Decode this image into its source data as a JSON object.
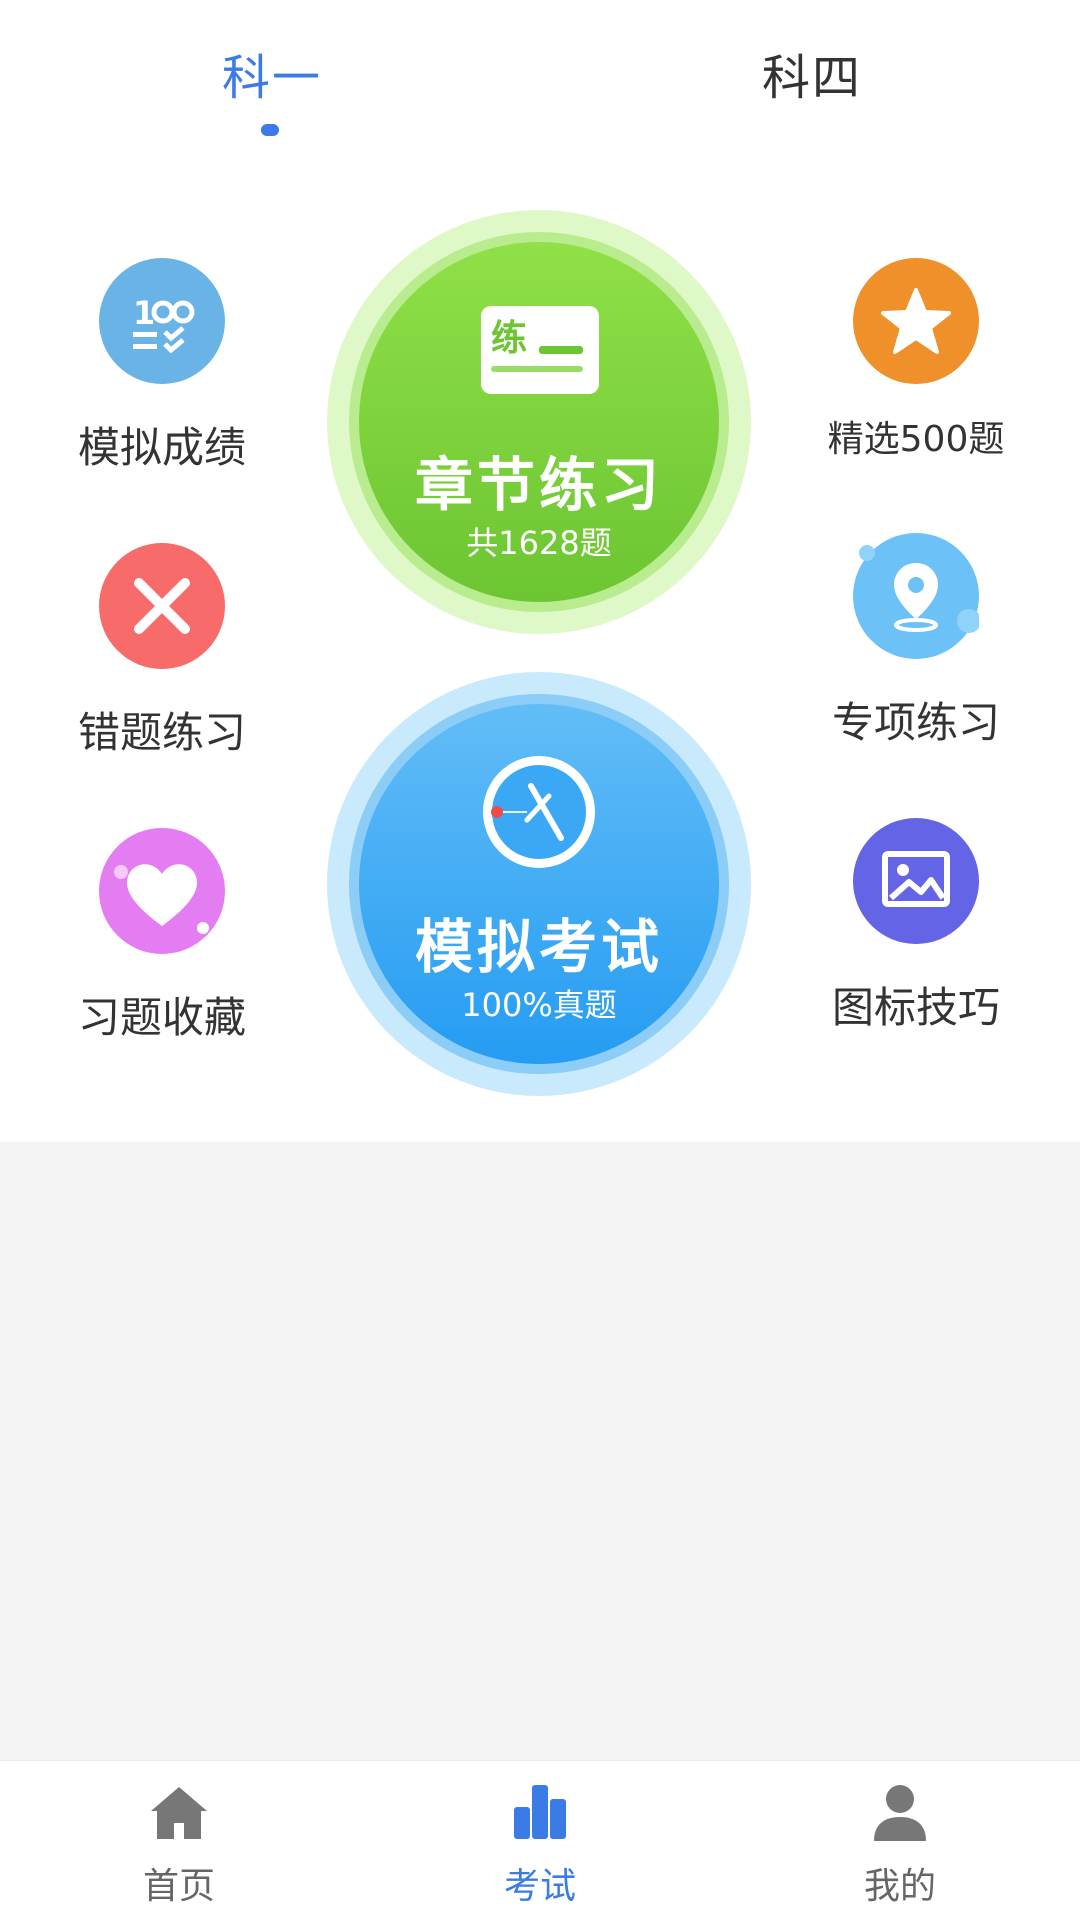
{
  "tabs": [
    {
      "label": "科一",
      "active": true
    },
    {
      "label": "科四",
      "active": false
    }
  ],
  "left_items": [
    {
      "label": "模拟成绩",
      "icon": "score-100-icon",
      "color": "#6ab3e6"
    },
    {
      "label": "错题练习",
      "icon": "close-x-icon",
      "color": "#f76b6b"
    },
    {
      "label": "习题收藏",
      "icon": "heart-icon",
      "color": "#e47cf2"
    }
  ],
  "right_items": [
    {
      "label": "精选500题",
      "icon": "star-icon",
      "color": "#f0902a"
    },
    {
      "label": "专项练习",
      "icon": "location-pin-icon",
      "color": "#6cc2f7"
    },
    {
      "label": "图标技巧",
      "icon": "image-icon",
      "color": "#6464e6"
    }
  ],
  "chapter": {
    "title": "章节练习",
    "subtitle": "共1628题",
    "badge": "练",
    "color": "#7ed23b"
  },
  "exam": {
    "title": "模拟考试",
    "subtitle": "100%真题",
    "color": "#3ba8f5"
  },
  "nav": [
    {
      "label": "首页",
      "icon": "home-icon",
      "active": false
    },
    {
      "label": "考试",
      "icon": "exam-chart-icon",
      "active": true
    },
    {
      "label": "我的",
      "icon": "user-icon",
      "active": false
    }
  ],
  "colors": {
    "accent": "#3b7be6",
    "background": "#f4f4f4"
  }
}
